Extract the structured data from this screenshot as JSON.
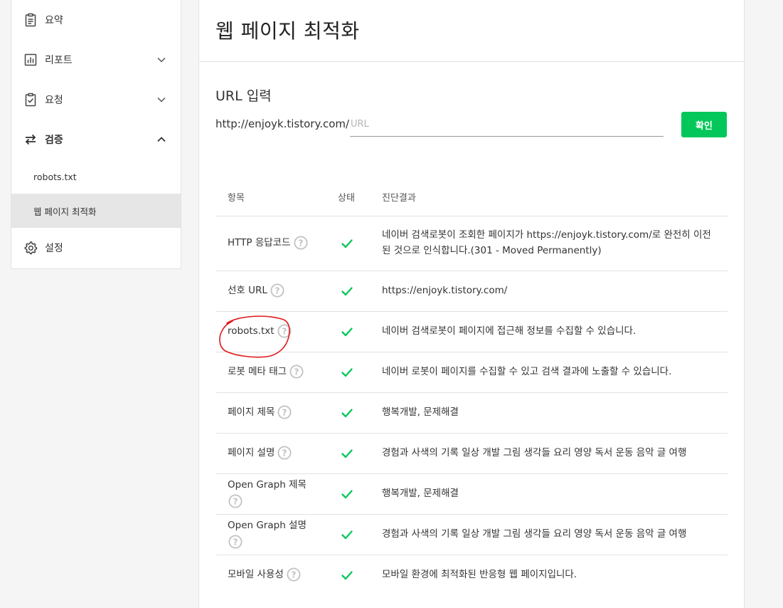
{
  "sidebar": {
    "items": [
      {
        "label": "요약",
        "icon": "clipboard-icon"
      },
      {
        "label": "리포트",
        "icon": "bar-chart-icon"
      },
      {
        "label": "요청",
        "icon": "clipboard-check-icon"
      },
      {
        "label": "검증",
        "icon": "swap-arrows-icon"
      },
      {
        "label": "설정",
        "icon": "gear-icon"
      }
    ],
    "subitems": [
      {
        "label": "robots.txt"
      },
      {
        "label": "웹 페이지 최적화"
      }
    ]
  },
  "main": {
    "title": "웹 페이지 최적화",
    "url_section": {
      "title": "URL 입력",
      "prefix": "http://enjoyk.tistory.com/",
      "placeholder": "URL",
      "value": "",
      "button": "확인"
    },
    "table": {
      "headers": [
        "항목",
        "상태",
        "진단결과"
      ],
      "rows": [
        {
          "item": "HTTP 응답코드",
          "status": "pass",
          "result": "네이버 검색로봇이 조회한 페이지가 https://enjoyk.tistory.com/로 완전히 이전된 것으로 인식합니다.(301 - Moved Permanently)"
        },
        {
          "item": "선호 URL",
          "status": "pass",
          "result": "https://enjoyk.tistory.com/"
        },
        {
          "item": "robots.txt",
          "status": "pass",
          "result": "네이버 검색로봇이 페이지에 접근해 정보를 수집할 수 있습니다."
        },
        {
          "item": "로봇 메타 태그",
          "status": "pass",
          "result": "네이버 로봇이 페이지를 수집할 수 있고 검색 결과에 노출할 수 있습니다."
        },
        {
          "item": "페이지 제목",
          "status": "pass",
          "result": "행복개발, 문제해결"
        },
        {
          "item": "페이지 설명",
          "status": "pass",
          "result": "경험과 사색의 기록 일상 개발 그림 생각들 요리 영양 독서 운동 음악 글 여행"
        },
        {
          "item": "Open Graph 제목",
          "status": "pass",
          "result": "행복개발, 문제해결"
        },
        {
          "item": "Open Graph 설명",
          "status": "pass",
          "result": "경험과 사색의 기록 일상 개발 그림 생각들 요리 영양 독서 운동 음악 글 여행"
        },
        {
          "item": "모바일 사용성",
          "status": "pass",
          "result": "모바일 환경에 최적화된 반응형 웹 페이지입니다."
        }
      ]
    }
  },
  "colors": {
    "accent": "#03c75a",
    "check": "#03c75a",
    "annotation": "#e0191b",
    "active_bg": "#e6e6e6"
  }
}
